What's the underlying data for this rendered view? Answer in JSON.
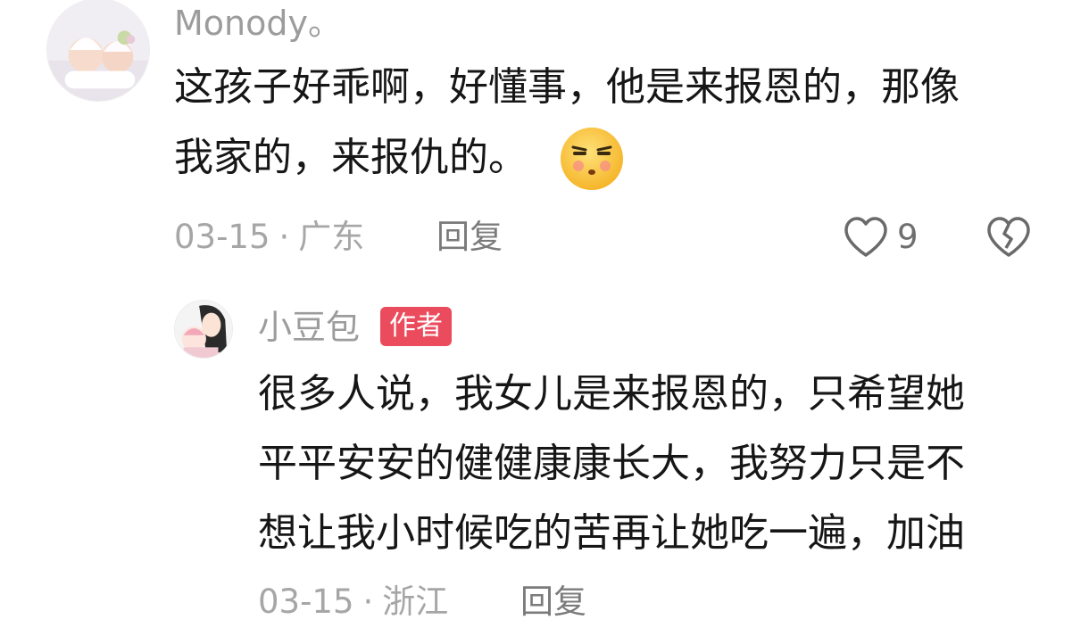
{
  "comment": {
    "username": "Monody。",
    "text_line1": "这孩子好乖啊，好懂事，他是来报恩的，那像",
    "text_line2": "我家的，来报仇的。",
    "emoji": "smirk-face-emoji",
    "date": "03-15",
    "location": "广东",
    "reply_label": "回复",
    "like_count": "9"
  },
  "reply": {
    "username": "小豆包",
    "badge": "作者",
    "text_line1": "很多人说，我女儿是来报恩的，只希望她",
    "text_line2": "平平安安的健健康康长大，我努力只是不",
    "text_line3": "想让我小时候吃的苦再让她吃一遍，加油",
    "date": "03-15",
    "location": "浙江",
    "reply_label": "回复"
  },
  "colors": {
    "badge": "#ea4c5e",
    "meta_text": "#a6a6a6",
    "username": "#9c9c9c"
  }
}
